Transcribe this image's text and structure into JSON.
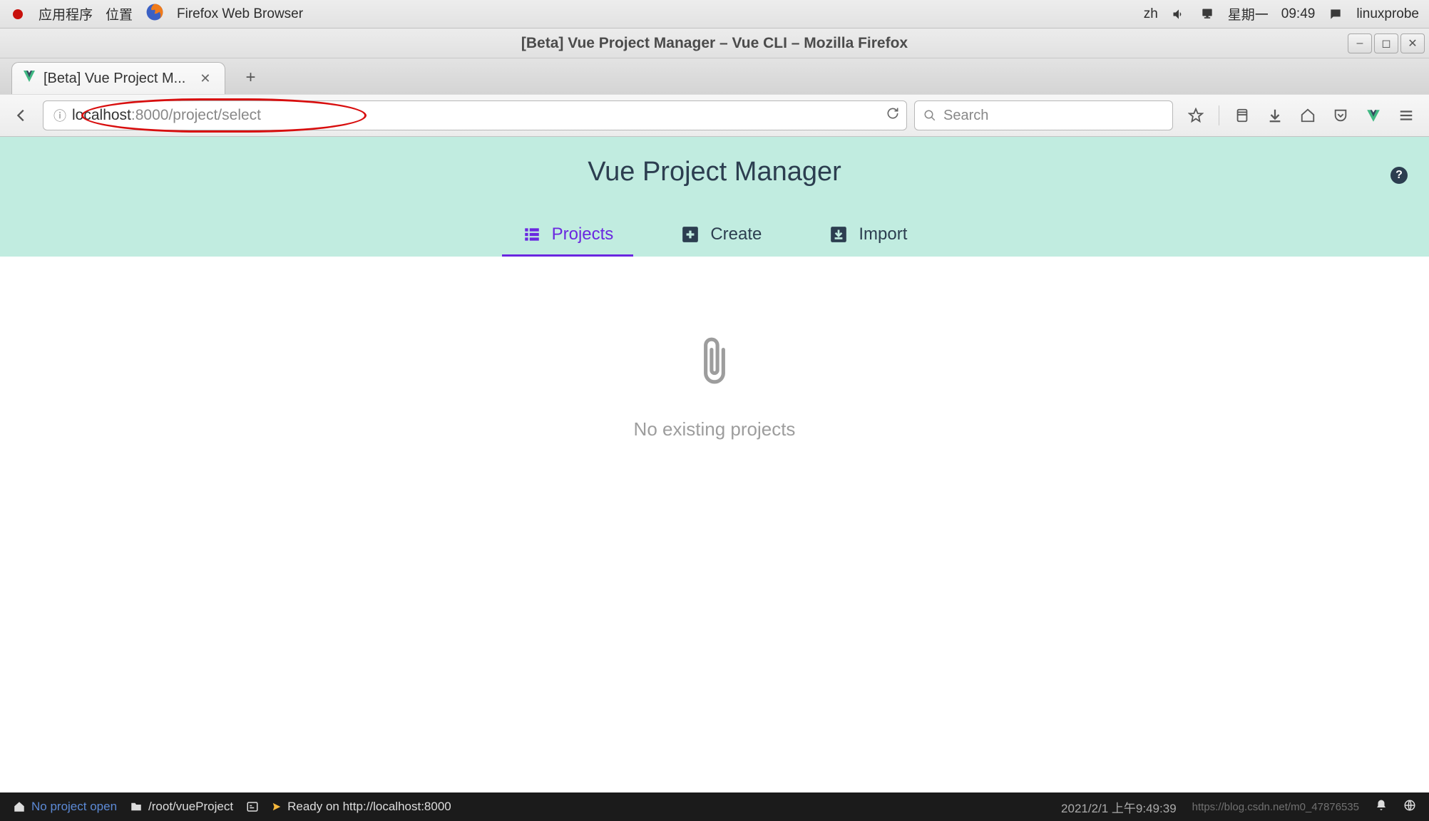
{
  "gnome": {
    "apps": "应用程序",
    "places": "位置",
    "browser_name": "Firefox Web Browser",
    "lang": "zh",
    "day": "星期一",
    "time": "09:49",
    "user": "linuxprobe"
  },
  "window": {
    "title": "[Beta] Vue Project Manager – Vue CLI – Mozilla Firefox"
  },
  "tab": {
    "label": "[Beta] Vue Project M..."
  },
  "urlbar": {
    "host": "localhost",
    "path": ":8000/project/select",
    "search_placeholder": "Search"
  },
  "vue": {
    "title": "Vue Project Manager",
    "tabs": {
      "projects": "Projects",
      "create": "Create",
      "import": "Import"
    },
    "empty": "No existing projects"
  },
  "status": {
    "no_project": "No project open",
    "path": "/root/vueProject",
    "ready": "Ready on http://localhost:8000",
    "timestamp": "2021/2/1 上午9:49:39",
    "watermark": "https://blog.csdn.net/m0_47876535"
  }
}
